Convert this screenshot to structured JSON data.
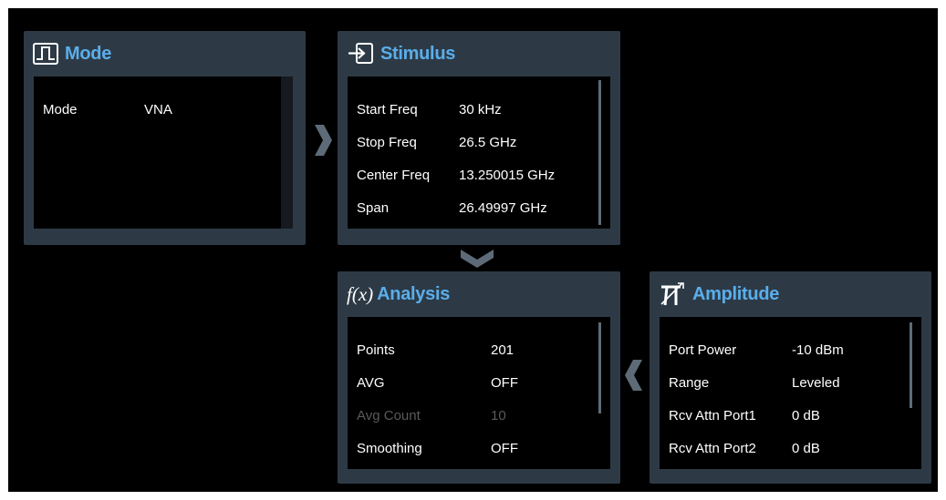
{
  "mode_panel": {
    "title": "Mode",
    "icon": "pulse-icon",
    "rows": [
      {
        "label": "Mode",
        "value": "VNA"
      }
    ]
  },
  "stimulus_panel": {
    "title": "Stimulus",
    "icon": "input-arrow-icon",
    "rows": [
      {
        "label": "Start Freq",
        "value": "30 kHz"
      },
      {
        "label": "Stop Freq",
        "value": "26.5 GHz"
      },
      {
        "label": "Center Freq",
        "value": "13.250015 GHz"
      },
      {
        "label": "Span",
        "value": "26.49997 GHz"
      }
    ]
  },
  "analysis_panel": {
    "title": "Analysis",
    "icon": "function-icon",
    "icon_text": "f(x)",
    "rows": [
      {
        "label": "Points",
        "value": "201"
      },
      {
        "label": "AVG",
        "value": "OFF"
      },
      {
        "label": "Avg Count",
        "value": "10",
        "disabled": true
      },
      {
        "label": "Smoothing",
        "value": "OFF"
      }
    ]
  },
  "amplitude_panel": {
    "title": "Amplitude",
    "icon": "amplitude-icon",
    "rows": [
      {
        "label": "Port Power",
        "value": "-10 dBm"
      },
      {
        "label": "Range",
        "value": "Leveled"
      },
      {
        "label": "Rcv Attn Port1",
        "value": "0 dB"
      },
      {
        "label": "Rcv Attn Port2",
        "value": "0 dB"
      }
    ]
  },
  "colors": {
    "accent": "#5aaeea",
    "panel_bg": "#2d3a46",
    "arrow": "#5d6b78"
  }
}
